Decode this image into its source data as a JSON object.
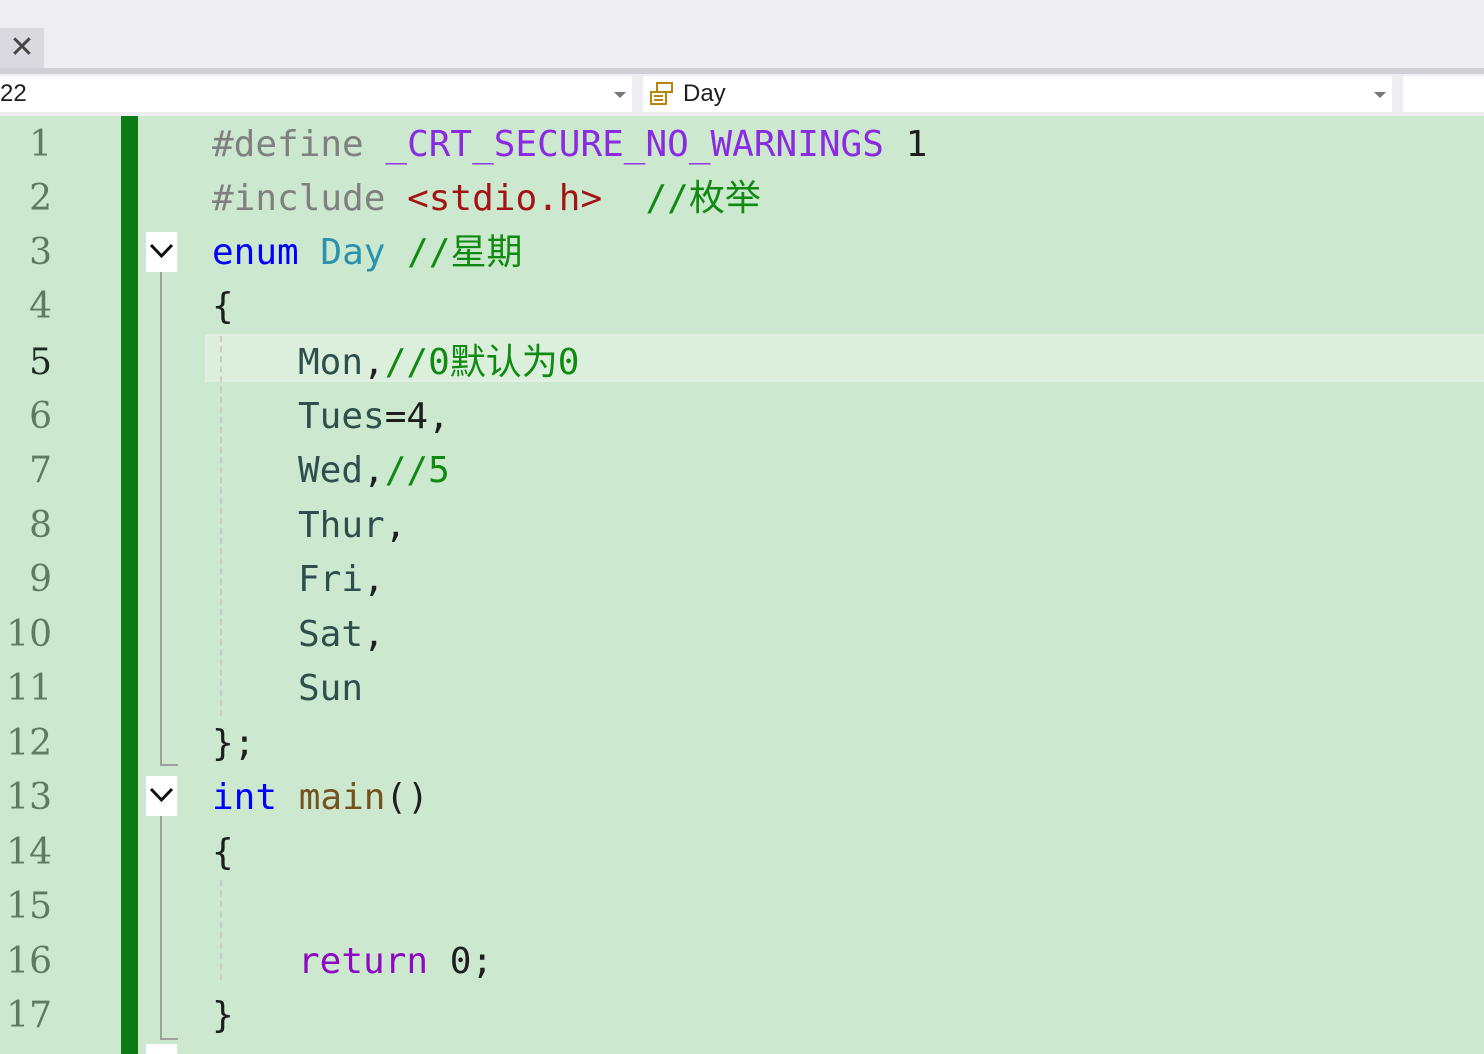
{
  "tab": {
    "close_glyph": "✕"
  },
  "navbar": {
    "scope_value": "22",
    "member_value": "Day",
    "member_icon": "enum-icon"
  },
  "editor": {
    "current_line": 5,
    "line_numbers": [
      "1",
      "2",
      "3",
      "4",
      "5",
      "6",
      "7",
      "8",
      "9",
      "10",
      "11",
      "12",
      "13",
      "14",
      "15",
      "16",
      "17"
    ],
    "lines": {
      "l1": {
        "pp": "#define ",
        "macro": "_CRT_SECURE_NO_WARNINGS",
        "rest": " 1"
      },
      "l2": {
        "pp": "#include ",
        "str": "<stdio.h>",
        "cmt": "  //枚举"
      },
      "l3": {
        "kw": "enum",
        "type": "Day",
        "cmt": " //星期"
      },
      "l4": {
        "text": "{"
      },
      "l5": {
        "enum": "Mon",
        "punct": ",",
        "cmt": "//0默认为0"
      },
      "l6": {
        "enum": "Tues",
        "rest": "=4,"
      },
      "l7": {
        "enum": "Wed",
        "punct": ",",
        "cmt": "//5"
      },
      "l8": {
        "enum": "Thur",
        "rest": ","
      },
      "l9": {
        "enum": "Fri",
        "rest": ","
      },
      "l10": {
        "enum": "Sat",
        "rest": ","
      },
      "l11": {
        "enum": "Sun"
      },
      "l12": {
        "text": "};"
      },
      "l13": {
        "kw": "int",
        "fn": "main",
        "rest": "()"
      },
      "l14": {
        "text": "{"
      },
      "l15": {
        "text": ""
      },
      "l16": {
        "ctl": "return",
        "rest": " 0;"
      },
      "l17": {
        "text": "}"
      }
    }
  },
  "colors": {
    "editor_bg": "#cce8cf",
    "change_bar": "#0e7a15",
    "comment": "#118a11",
    "keyword": "#0000ff",
    "macro": "#8a2be2"
  }
}
